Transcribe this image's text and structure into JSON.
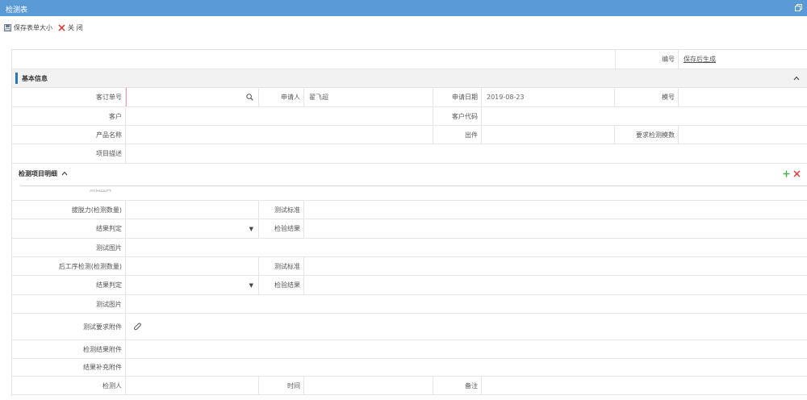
{
  "window": {
    "title": "检测表"
  },
  "toolbar": {
    "save_size": "保存表单大小",
    "close": "关 闭"
  },
  "header": {
    "code_label": "编号",
    "code_value": "保存后生成"
  },
  "basic": {
    "title": "基本信息",
    "order_label": "客订单号",
    "applicant_label": "申请人",
    "applicant_value": "翟飞超",
    "apply_date_label": "申请日期",
    "apply_date_value": "2019-08-23",
    "model_label": "模号",
    "customer_label": "客户",
    "customer_code_label": "客户代码",
    "product_label": "产品名称",
    "piece_label": "出件",
    "required_qty_label": "要求检测模数",
    "project_desc_label": "项目描述"
  },
  "detail": {
    "title": "检测项目明细",
    "cut_label": "测试图片",
    "rows": [
      {
        "label": "拔脱力(检测数量)",
        "right_label": "测试标准"
      },
      {
        "label": "结果判定",
        "right_label": "检验结果"
      },
      {
        "label": "测试图片"
      },
      {
        "label": "后工序检测(检测数量)",
        "right_label": "测试标准"
      },
      {
        "label": "结果判定",
        "right_label": "检验结果"
      },
      {
        "label": "测试图片"
      },
      {
        "label": "测试要求附件"
      },
      {
        "label": "检测结果附件"
      },
      {
        "label": "结果补充附件"
      }
    ],
    "inspector_label": "检测人",
    "time_label": "时间",
    "remark_label": "备注"
  },
  "icons": {
    "dropdown": "▼",
    "restore": "restore-icon",
    "save": "save-icon",
    "close": "close-x-icon",
    "search": "search-icon",
    "add": "plus-icon",
    "delete": "x-icon",
    "attach": "paperclip-icon"
  },
  "colors": {
    "titlebar": "#5b9bd5",
    "accent": "#2e75b6",
    "add": "#4caf50",
    "delete": "#e53935"
  }
}
